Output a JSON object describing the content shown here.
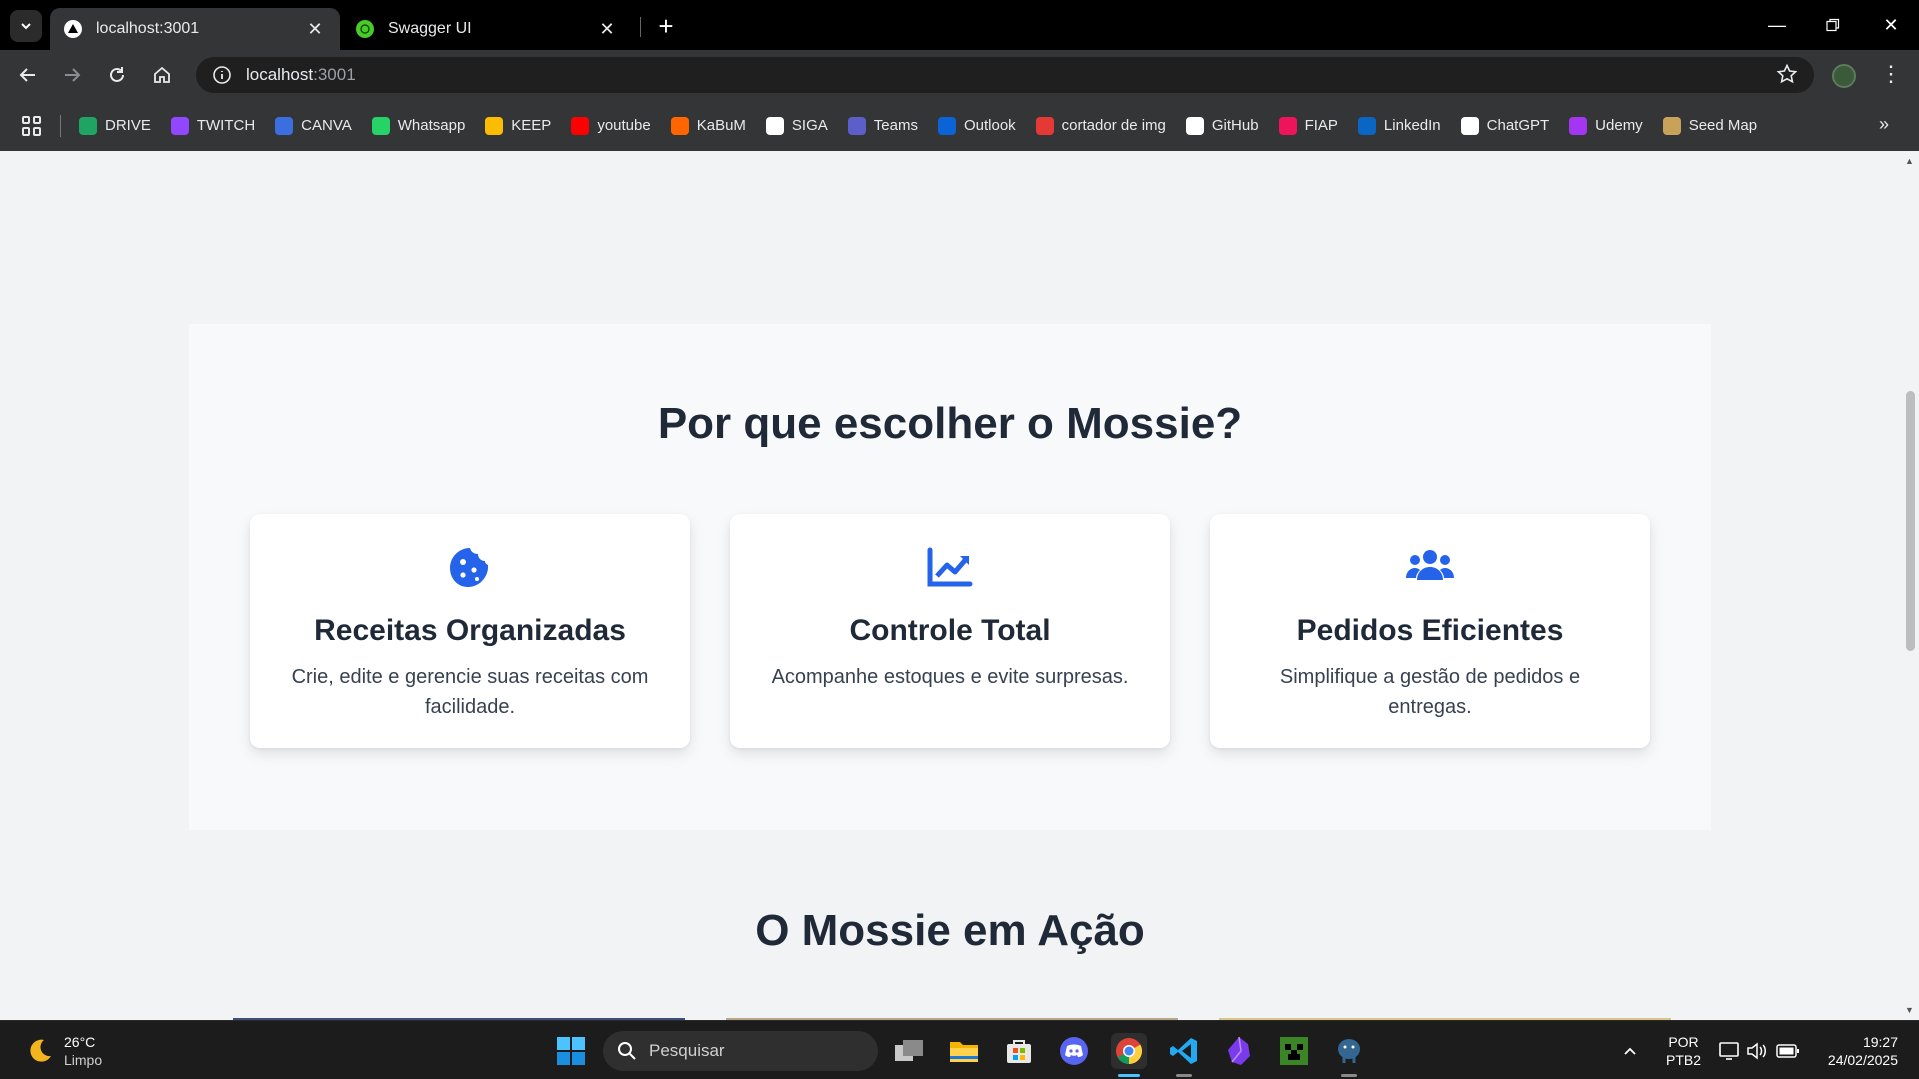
{
  "browser": {
    "tabs": [
      {
        "title": "localhost:3001",
        "active": true
      },
      {
        "title": "Swagger UI",
        "active": false
      }
    ],
    "url_host": "localhost",
    "url_port": ":3001",
    "bookmarks": [
      {
        "label": "DRIVE",
        "icon": "google-drive-icon",
        "color": "#1fa463"
      },
      {
        "label": "TWITCH",
        "icon": "twitch-icon",
        "color": "#9146ff"
      },
      {
        "label": "CANVA",
        "icon": "canva-icon",
        "color": "#3b6fe0"
      },
      {
        "label": "Whatsapp",
        "icon": "whatsapp-icon",
        "color": "#25d366"
      },
      {
        "label": "KEEP",
        "icon": "google-keep-icon",
        "color": "#fbbc04"
      },
      {
        "label": "youtube",
        "icon": "youtube-icon",
        "color": "#ff0000"
      },
      {
        "label": "KaBuM",
        "icon": "kabum-icon",
        "color": "#ff6500"
      },
      {
        "label": "SIGA",
        "icon": "siga-icon",
        "color": "#ffffff"
      },
      {
        "label": "Teams",
        "icon": "teams-icon",
        "color": "#5b5fc7"
      },
      {
        "label": "Outlook",
        "icon": "outlook-icon",
        "color": "#0a64d6"
      },
      {
        "label": "cortador de img",
        "icon": "image-cutter-icon",
        "color": "#e53935"
      },
      {
        "label": "GitHub",
        "icon": "github-icon",
        "color": "#ffffff"
      },
      {
        "label": "FIAP",
        "icon": "fiap-icon",
        "color": "#ed145b"
      },
      {
        "label": "LinkedIn",
        "icon": "linkedin-icon",
        "color": "#0a66c2"
      },
      {
        "label": "ChatGPT",
        "icon": "chatgpt-icon",
        "color": "#ffffff"
      },
      {
        "label": "Udemy",
        "icon": "udemy-icon",
        "color": "#a435f0"
      },
      {
        "label": "Seed Map",
        "icon": "seed-map-icon",
        "color": "#c9a25a"
      }
    ]
  },
  "page": {
    "features_title": "Por que escolher o Mossie?",
    "cards": [
      {
        "icon": "cookie-icon",
        "title": "Receitas Organizadas",
        "text": "Crie, edite e gerencie suas receitas com facilidade."
      },
      {
        "icon": "chart-line-icon",
        "title": "Controle Total",
        "text": "Acompanhe estoques e evite surpresas."
      },
      {
        "icon": "users-icon",
        "title": "Pedidos Eficientes",
        "text": "Simplifique a gestão de pedidos e entregas."
      }
    ],
    "action_title": "O Mossie em Ação",
    "accent_color": "#2563eb"
  },
  "taskbar": {
    "weather_temp": "26°C",
    "weather_cond": "Limpo",
    "search_placeholder": "Pesquisar",
    "lang": "POR",
    "layout": "PTB2",
    "time": "19:27",
    "date": "24/02/2025"
  }
}
